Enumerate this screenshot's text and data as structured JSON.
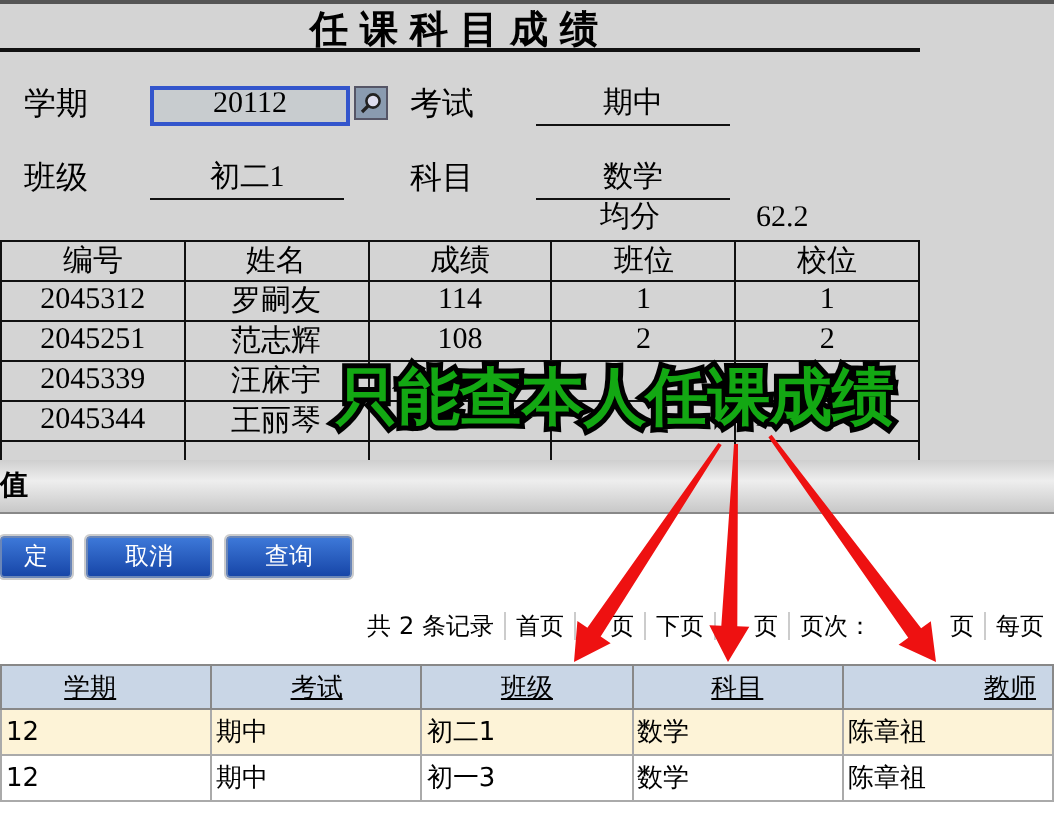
{
  "report": {
    "title": "任课科目成绩",
    "fields": [
      {
        "label": "学期",
        "value": "20112",
        "kind": "lookup"
      },
      {
        "label": "考试",
        "value": "期中",
        "kind": "text"
      },
      {
        "label": "班级",
        "value": "初二1",
        "kind": "text"
      },
      {
        "label": "科目",
        "value": "数学",
        "kind": "text"
      }
    ],
    "average": {
      "label": "均分",
      "value": "62.2"
    },
    "table": {
      "columns": [
        "编号",
        "姓名",
        "成绩",
        "班位",
        "校位"
      ],
      "rows": [
        [
          "2045312",
          "罗嗣友",
          "114",
          "1",
          "1"
        ],
        [
          "2045251",
          "范志辉",
          "108",
          "2",
          "2"
        ],
        [
          "2045339",
          "汪庥宇"
        ],
        [
          "2045344",
          "王丽琴"
        ],
        []
      ]
    }
  },
  "annotation": {
    "text": "只能查本人任课成绩"
  },
  "dialog": {
    "title": "值",
    "buttons": [
      "定",
      "取消",
      "查询"
    ],
    "pager": [
      "共 2 条记录",
      "首页",
      "页",
      "下页",
      "页",
      "页次：",
      "页",
      "每页"
    ],
    "grid": {
      "columns": [
        "学期",
        "考试",
        "班级",
        "科目",
        "教师"
      ],
      "rows": [
        {
          "cells": [
            "12",
            "期中",
            "初二1",
            "数学",
            "陈章祖"
          ],
          "selected": true
        },
        {
          "cells": [
            "12",
            "期中",
            "初一3",
            "数学",
            "陈章祖"
          ],
          "selected": false
        }
      ]
    }
  }
}
